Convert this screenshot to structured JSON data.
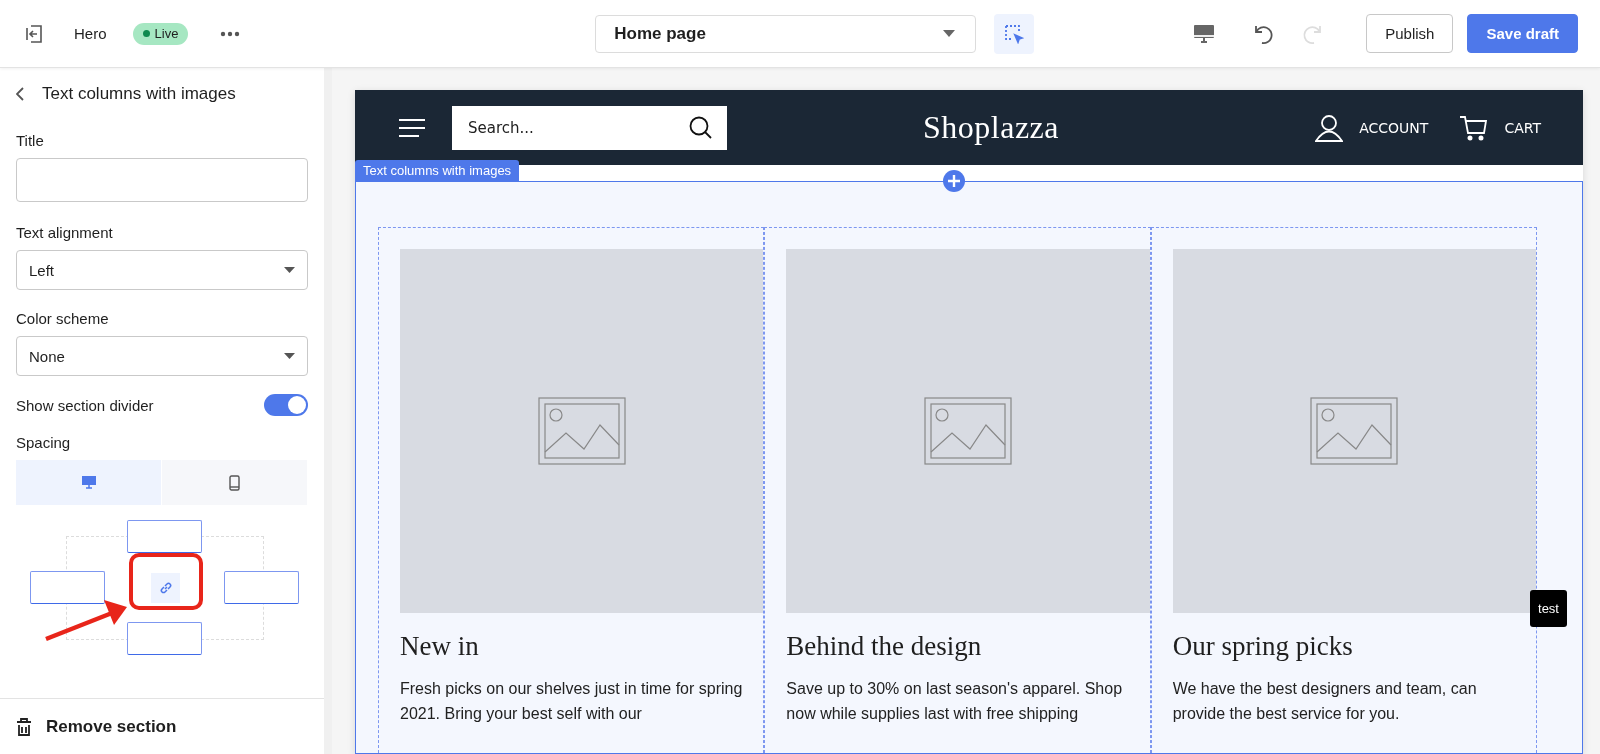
{
  "topbar": {
    "title": "Hero",
    "status": {
      "label": "Live",
      "live": true
    },
    "page_select": {
      "value": "Home page"
    },
    "inspect": {
      "selected": true
    },
    "undo": {
      "disabled": false
    },
    "redo": {
      "disabled": true
    },
    "publish": "Publish",
    "save_draft": "Save draft"
  },
  "panel": {
    "title": "Text columns with images",
    "fields": [
      {
        "kind": "text",
        "label": "Title"
      },
      {
        "kind": "select",
        "label": "Text alignment",
        "value": "Left"
      },
      {
        "kind": "select",
        "label": "Color scheme",
        "value": "None"
      },
      {
        "kind": "toggle",
        "label": "Show section divider",
        "on": true
      },
      {
        "kind": "spacing",
        "label": "Spacing",
        "tabs": [
          {
            "kind": "desktop",
            "selected": true
          },
          {
            "kind": "mobile",
            "selected": false
          }
        ]
      }
    ],
    "remove": "Remove section"
  },
  "preview": {
    "store": {
      "search": {
        "placeholder": "Search..."
      },
      "logo": "Shoplazza",
      "account": "ACCOUNT",
      "cart": "CART"
    },
    "section": {
      "label": "Text columns with images",
      "columns": [
        {
          "title": "New in",
          "text": "Fresh picks on our shelves just in time for spring 2021. Bring your best self with our"
        },
        {
          "title": "Behind the design",
          "text": "Save up to 30% on last season's apparel. Shop now while supplies last with free shipping"
        },
        {
          "title": "Our spring picks",
          "text": "We have the best designers and team, can provide the best service for you."
        }
      ]
    },
    "tooltip": "test"
  }
}
